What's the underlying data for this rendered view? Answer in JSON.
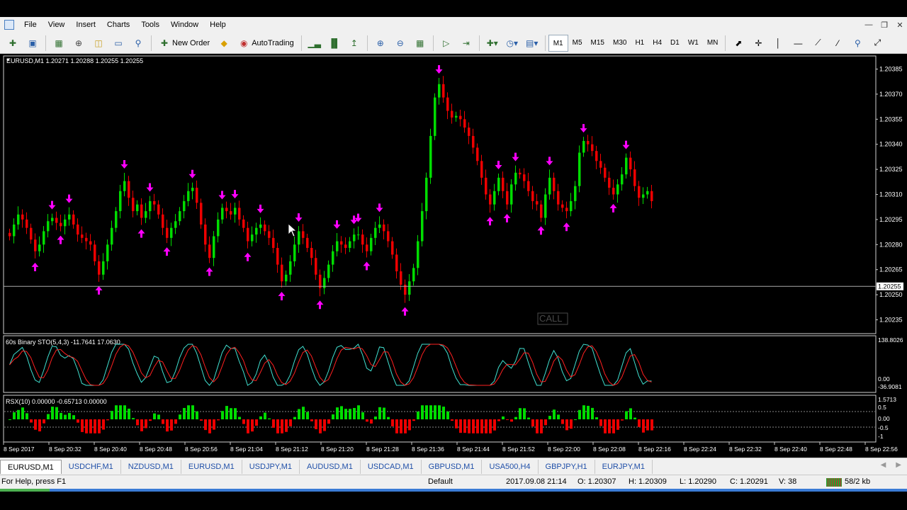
{
  "menu": [
    "File",
    "View",
    "Insert",
    "Charts",
    "Tools",
    "Window",
    "Help"
  ],
  "toolbar": {
    "new_order": "New Order",
    "autotrading": "AutoTrading",
    "timeframes": [
      "M1",
      "M5",
      "M15",
      "M30",
      "H1",
      "H4",
      "D1",
      "W1",
      "MN"
    ],
    "active_timeframe": "M1"
  },
  "chart": {
    "header": "EURUSD,M1  1.20271 1.20288 1.20255 1.20255",
    "price_labels": [
      "1.20385",
      "1.20370",
      "1.20355",
      "1.20340",
      "1.20325",
      "1.20310",
      "1.20295",
      "1.20280",
      "1.20265",
      "1.20250",
      "1.20235"
    ],
    "current_price": "1.20255",
    "call_label": "CALL",
    "colors": {
      "bull": "#00dd00",
      "bear": "#ee0000",
      "arrow": "#ff00ff",
      "bg": "#000000"
    }
  },
  "indicator1": {
    "header": "60s Binary STO(5,4,3) -11.7641 17.0630",
    "labels": [
      "138.8026",
      "0.00",
      "-36.9081"
    ]
  },
  "indicator2": {
    "header": "RSX(10) 0.00000 -0.65713 0.00000",
    "labels": [
      "1.5713",
      "0.5",
      "0.00",
      "-0.5",
      "-1"
    ]
  },
  "time_labels": [
    "8 Sep 2017",
    "8 Sep 20:32",
    "8 Sep 20:40",
    "8 Sep 20:48",
    "8 Sep 20:56",
    "8 Sep 21:04",
    "8 Sep 21:12",
    "8 Sep 21:20",
    "8 Sep 21:28",
    "8 Sep 21:36",
    "8 Sep 21:44",
    "8 Sep 21:52",
    "8 Sep 22:00",
    "8 Sep 22:08",
    "8 Sep 22:16",
    "8 Sep 22:24",
    "8 Sep 22:32",
    "8 Sep 22:40",
    "8 Sep 22:48",
    "8 Sep 22:56"
  ],
  "tabs": [
    "EURUSD,M1",
    "USDCHF,M1",
    "NZDUSD,M1",
    "EURUSD,M1",
    "USDJPY,M1",
    "AUDUSD,M1",
    "USDCAD,M1",
    "GBPUSD,M1",
    "USA500,H4",
    "GBPJPY,H1",
    "EURJPY,M1"
  ],
  "status": {
    "help": "For Help, press F1",
    "profile": "Default",
    "datetime": "2017.09.08 21:14",
    "open": "O: 1.20307",
    "high": "H: 1.20309",
    "low": "L: 1.20290",
    "close": "C: 1.20291",
    "volume": "V: 38",
    "traffic": "58/2 kb"
  },
  "chart_data": {
    "type": "candlestick",
    "symbol": "EURUSD",
    "timeframe": "M1",
    "ylim": [
      1.20228,
      1.20392
    ],
    "closes": [
      1.20285,
      1.20292,
      1.20298,
      1.20295,
      1.2029,
      1.20283,
      1.20276,
      1.2028,
      1.20288,
      1.20294,
      1.20296,
      1.20293,
      1.20291,
      1.20295,
      1.20298,
      1.20292,
      1.20286,
      1.20284,
      1.20282,
      1.2028,
      1.2027,
      1.20262,
      1.2027,
      1.2028,
      1.2029,
      1.203,
      1.20312,
      1.20318,
      1.20308,
      1.203,
      1.20304,
      1.20296,
      1.203,
      1.20306,
      1.20304,
      1.20298,
      1.2029,
      1.20284,
      1.2029,
      1.20294,
      1.203,
      1.20306,
      1.20312,
      1.20314,
      1.20305,
      1.20292,
      1.2028,
      1.20272,
      1.20285,
      1.20295,
      1.20302,
      1.203,
      1.20298,
      1.20302,
      1.20295,
      1.2029,
      1.20282,
      1.20286,
      1.2029,
      1.20292,
      1.20288,
      1.20284,
      1.20278,
      1.20268,
      1.20258,
      1.20262,
      1.2027,
      1.2028,
      1.20288,
      1.20284,
      1.20278,
      1.20272,
      1.20262,
      1.20254,
      1.2026,
      1.20268,
      1.20276,
      1.20282,
      1.2028,
      1.20278,
      1.20282,
      1.20286,
      1.20286,
      1.2028,
      1.20276,
      1.20284,
      1.2029,
      1.20292,
      1.20288,
      1.20282,
      1.20274,
      1.20264,
      1.20256,
      1.2025,
      1.20258,
      1.20266,
      1.20282,
      1.203,
      1.2032,
      1.20345,
      1.20368,
      1.20376,
      1.20368,
      1.2036,
      1.20356,
      1.20357,
      1.20355,
      1.2035,
      1.20345,
      1.20338,
      1.2033,
      1.2032,
      1.2031,
      1.20304,
      1.20312,
      1.2032,
      1.20312,
      1.20304,
      1.20316,
      1.20323,
      1.20322,
      1.20318,
      1.20312,
      1.20306,
      1.20304,
      1.20296,
      1.2031,
      1.2032,
      1.20312,
      1.20304,
      1.20302,
      1.203,
      1.20306,
      1.20315,
      1.20335,
      1.20342,
      1.2034,
      1.20336,
      1.2033,
      1.20326,
      1.2032,
      1.20314,
      1.2031,
      1.20316,
      1.20322,
      1.20332,
      1.20325,
      1.20315,
      1.20308,
      1.2031,
      1.20312,
      1.20306
    ]
  }
}
